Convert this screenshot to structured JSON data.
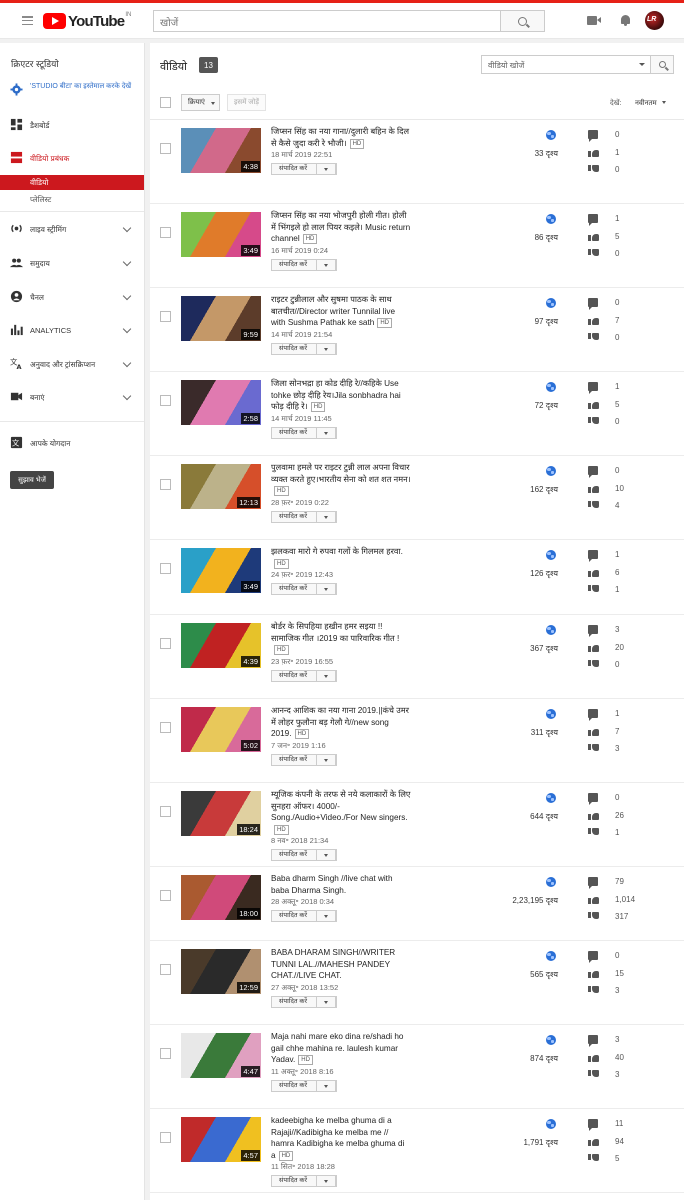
{
  "header": {
    "logo_text": "YouTube",
    "region": "IN",
    "search_placeholder": "खोजें",
    "icons": [
      "menu-icon",
      "search-icon",
      "video-camera-icon",
      "bell-icon",
      "avatar"
    ]
  },
  "sidebar": {
    "title": "क्रिएटर स्टूडियो",
    "beta_link": "'STUDIO बीटा' का इस्तेमाल करके देखें",
    "items": [
      {
        "label": "डैशबोर्ड",
        "icon": "dashboard-icon"
      },
      {
        "label": "वीडियो प्रबंधक",
        "icon": "video-manager-icon"
      },
      {
        "label": "वीडियो",
        "icon": ""
      },
      {
        "label": "प्लेलिस्ट",
        "icon": ""
      },
      {
        "label": "लाइव स्ट्रीमिंग",
        "icon": "live-icon"
      },
      {
        "label": "समुदाय",
        "icon": "community-icon"
      },
      {
        "label": "चैनल",
        "icon": "channel-icon"
      },
      {
        "label": "ANALYTICS",
        "icon": "analytics-icon"
      },
      {
        "label": "अनुवाद और ट्रांसक्रिप्शन",
        "icon": "translate-icon"
      },
      {
        "label": "बनाएं",
        "icon": "create-icon"
      },
      {
        "label": "आपके योगदान",
        "icon": "contributions-icon"
      }
    ],
    "feedback_label": "सुझाव भेजें",
    "accent_color": "#cc181e"
  },
  "main": {
    "title": "वीडियो",
    "count": "13",
    "search_placeholder": "वीडियो खोजें",
    "actions_label": "क्रियाएं",
    "add_to_label": "इसमें जोड़ें",
    "sort_label": "देखें:",
    "sort_value": "नवीनतम",
    "videos": [
      {
        "title": "जिप्सन सिंह का नया गाना//दुलारी बहिन के दिल से कैसे जुदा करी रे भौजी।",
        "date": "18 मार्च 2019 22:51",
        "duration": "4:38",
        "views": "33 दृश्य",
        "comments": "0",
        "likes": "1",
        "dislikes": "0",
        "hd": "HD",
        "edit": "संपादित करें"
      },
      {
        "title": "जिप्सन सिंह का नया भोजपुरी होली गीत। होली में भिंगइले हो लाल पियर कइले। Music return channel",
        "date": "16 मार्च 2019 0:24",
        "duration": "3:49",
        "views": "86 दृश्य",
        "comments": "1",
        "likes": "5",
        "dislikes": "0",
        "hd": "HD",
        "edit": "संपादित करें"
      },
      {
        "title": "राइटर टुन्नीलाल और सुषमा पाठक के साथ बातचीत//Director writer Tunnilal live with Sushma Pathak ke sath",
        "date": "14 मार्च 2019 21:54",
        "duration": "9:59",
        "views": "97 दृश्य",
        "comments": "0",
        "likes": "7",
        "dislikes": "0",
        "hd": "HD",
        "edit": "संपादित करें"
      },
      {
        "title": "जिला सोनभद्रा हा कोड दीहि रे//कहिके Use tohke छोड़ दीहि रेय।Jila sonbhadra hai फोड़ दीहि रे।",
        "date": "14 मार्च 2019 11:45",
        "duration": "2:58",
        "views": "72 दृश्य",
        "comments": "1",
        "likes": "5",
        "dislikes": "0",
        "hd": "HD",
        "edit": "संपादित करें"
      },
      {
        "title": "पुलवामा हमले पर राइटर टुन्नी लाल अपना विचार व्यक्त करते हुए।भारतीय सेना को शत शत नमन।",
        "date": "28 फ़र॰ 2019 0:22",
        "duration": "12:13",
        "views": "162 दृश्य",
        "comments": "0",
        "likes": "10",
        "dislikes": "4",
        "hd": "HD",
        "edit": "संपादित करें"
      },
      {
        "title": "झलकवा मारो गे रुपवा गलों के गिलमल हरवा.",
        "date": "24 फ़र॰ 2019 12:43",
        "duration": "3:49",
        "views": "126 दृश्य",
        "comments": "1",
        "likes": "6",
        "dislikes": "1",
        "hd": "HD",
        "edit": "संपादित करें"
      },
      {
        "title": "बोर्डर के सिपहिया हखीन हमर सइया !! सामाजिक गीत ।2019 का पारिवारिक गीत !",
        "date": "23 फ़र॰ 2019 16:55",
        "duration": "4:39",
        "views": "367 दृश्य",
        "comments": "3",
        "likes": "20",
        "dislikes": "0",
        "hd": "HD",
        "edit": "संपादित करें"
      },
      {
        "title": "आनन्द आशिक का नया गाना 2019.||कंचे उमर में लोहर फुलौना बड़ गेलौ गे//new song 2019.",
        "date": "7 जन॰ 2019 1:16",
        "duration": "5:02",
        "views": "311 दृश्य",
        "comments": "1",
        "likes": "7",
        "dislikes": "3",
        "hd": "HD",
        "edit": "संपादित करें"
      },
      {
        "title": "म्यूजिक कंपनी के तरफ से नये कलाकारों के लिए सुनहरा ऑफर। 4000/- Song./Audio+Video./For New singers.",
        "date": "8 नव॰ 2018 21:34",
        "duration": "18:24",
        "views": "644 दृश्य",
        "comments": "0",
        "likes": "26",
        "dislikes": "1",
        "hd": "HD",
        "edit": "संपादित करें"
      },
      {
        "title": "Baba dharm Singh //live chat with baba Dharma Singh.",
        "date": "28 अक्तू॰ 2018 0:34",
        "duration": "18:00",
        "views": "2,23,195 दृश्य",
        "comments": "79",
        "likes": "1,014",
        "dislikes": "317",
        "hd": "",
        "edit": "संपादित करें"
      },
      {
        "title": "BABA DHARAM SINGH//WRITER TUNNI LAL.//MAHESH PANDEY CHAT.//LIVE CHAT.",
        "date": "27 अक्तू॰ 2018 13:52",
        "duration": "12:59",
        "views": "565 दृश्य",
        "comments": "0",
        "likes": "15",
        "dislikes": "3",
        "hd": "",
        "edit": "संपादित करें"
      },
      {
        "title": "Maja nahi mare eko dina re/shadi ho gail chhe mahina re. laulesh kumar Yadav.",
        "date": "11 अक्तू॰ 2018 8:16",
        "duration": "4:47",
        "views": "874 दृश्य",
        "comments": "3",
        "likes": "40",
        "dislikes": "3",
        "hd": "HD",
        "edit": "संपादित करें"
      },
      {
        "title": "kadeebigha ke melba ghuma di a Rajaji//Kadibigha ke melba me // hamra Kadibigha ke melba ghuma di a",
        "date": "11 सित॰ 2018 18:28",
        "duration": "4:57",
        "views": "1,791 दृश्य",
        "comments": "11",
        "likes": "94",
        "dislikes": "5",
        "hd": "HD",
        "edit": "संपादित करें"
      }
    ]
  }
}
